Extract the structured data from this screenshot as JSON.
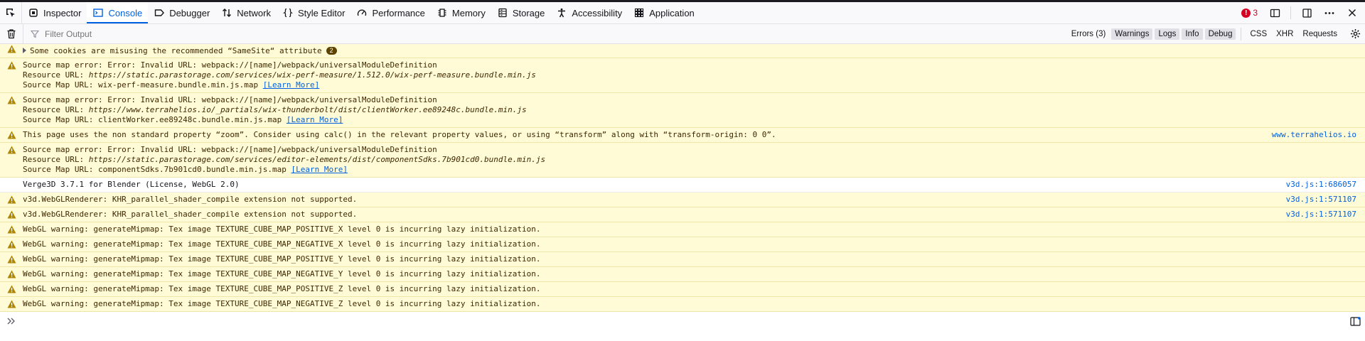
{
  "tabs": [
    {
      "label": "Inspector",
      "icon": "inspector-icon"
    },
    {
      "label": "Console",
      "icon": "console-icon"
    },
    {
      "label": "Debugger",
      "icon": "debugger-icon"
    },
    {
      "label": "Network",
      "icon": "network-icon"
    },
    {
      "label": "Style Editor",
      "icon": "style-editor-icon"
    },
    {
      "label": "Performance",
      "icon": "performance-icon"
    },
    {
      "label": "Memory",
      "icon": "memory-icon"
    },
    {
      "label": "Storage",
      "icon": "storage-icon"
    },
    {
      "label": "Accessibility",
      "icon": "accessibility-icon"
    },
    {
      "label": "Application",
      "icon": "application-icon"
    }
  ],
  "error_count": "3",
  "toolbar": {
    "filter_placeholder": "Filter Output",
    "levels": {
      "errors": "Errors (3)",
      "warnings": "Warnings",
      "logs": "Logs",
      "info": "Info",
      "debug": "Debug"
    },
    "css": "CSS",
    "xhr": "XHR",
    "requests": "Requests"
  },
  "messages": [
    {
      "type": "warn",
      "text": "Some cookies are misusing the recommended “SameSite“ attribute",
      "count": "2"
    },
    {
      "type": "warn",
      "line1": "Source map error: Error: Invalid URL: webpack://[name]/webpack/universalModuleDefinition",
      "line2_label": "Resource URL: ",
      "line2_url": "https://static.parastorage.com/services/wix-perf-measure/1.512.0/wix-perf-measure.bundle.min.js",
      "line3_label": "Source Map URL: wix-perf-measure.bundle.min.js.map ",
      "learn": "[Learn More]"
    },
    {
      "type": "warn",
      "line1": "Source map error: Error: Invalid URL: webpack://[name]/webpack/universalModuleDefinition",
      "line2_label": "Resource URL: ",
      "line2_url": "https://www.terrahelios.io/_partials/wix-thunderbolt/dist/clientWorker.ee89248c.bundle.min.js",
      "line3_label": "Source Map URL: clientWorker.ee89248c.bundle.min.js.map ",
      "learn": "[Learn More]"
    },
    {
      "type": "warn",
      "text": "This page uses the non standard property “zoom”. Consider using calc() in the relevant property values, or using “transform” along with “transform-origin: 0 0”.",
      "source": "www.terrahelios.io"
    },
    {
      "type": "warn",
      "line1": "Source map error: Error: Invalid URL: webpack://[name]/webpack/universalModuleDefinition",
      "line2_label": "Resource URL: ",
      "line2_url": "https://static.parastorage.com/services/editor-elements/dist/componentSdks.7b901cd0.bundle.min.js",
      "line3_label": "Source Map URL: componentSdks.7b901cd0.bundle.min.js.map ",
      "learn": "[Learn More]"
    },
    {
      "type": "log",
      "text": "Verge3D 3.7.1 for Blender (License, WebGL 2.0)",
      "source": "v3d.js:1:686057"
    },
    {
      "type": "warn",
      "text": "v3d.WebGLRenderer: KHR_parallel_shader_compile extension not supported.",
      "source": "v3d.js:1:571107"
    },
    {
      "type": "warn",
      "text": "v3d.WebGLRenderer: KHR_parallel_shader_compile extension not supported.",
      "source": "v3d.js:1:571107"
    },
    {
      "type": "warn",
      "text": "WebGL warning: generateMipmap: Tex image TEXTURE_CUBE_MAP_POSITIVE_X level 0 is incurring lazy initialization."
    },
    {
      "type": "warn",
      "text": "WebGL warning: generateMipmap: Tex image TEXTURE_CUBE_MAP_NEGATIVE_X level 0 is incurring lazy initialization."
    },
    {
      "type": "warn",
      "text": "WebGL warning: generateMipmap: Tex image TEXTURE_CUBE_MAP_POSITIVE_Y level 0 is incurring lazy initialization."
    },
    {
      "type": "warn",
      "text": "WebGL warning: generateMipmap: Tex image TEXTURE_CUBE_MAP_NEGATIVE_Y level 0 is incurring lazy initialization."
    },
    {
      "type": "warn",
      "text": "WebGL warning: generateMipmap: Tex image TEXTURE_CUBE_MAP_POSITIVE_Z level 0 is incurring lazy initialization."
    },
    {
      "type": "warn",
      "text": "WebGL warning: generateMipmap: Tex image TEXTURE_CUBE_MAP_NEGATIVE_Z level 0 is incurring lazy initialization."
    }
  ],
  "colors": {
    "accent": "#0061e0",
    "warning_bg": "#fffbd6",
    "warning_icon": "#b08500",
    "error": "#d70022"
  }
}
